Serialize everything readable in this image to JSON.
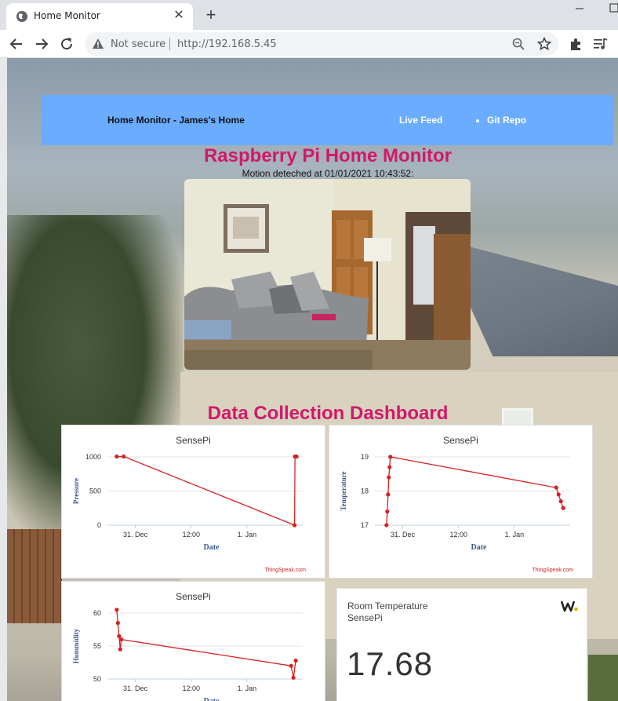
{
  "browser": {
    "tab_title": "Home Monitor",
    "security_label": "Not secure",
    "url": "http://192.168.5.45"
  },
  "nav": {
    "brand": "Home Monitor - James's Home",
    "live_feed": "Live Feed",
    "git_repo": "Git Repo"
  },
  "page": {
    "title": "Raspberry Pi Home Monitor",
    "motion_text": "Motion deteched at 01/01/2021 10:43:52:",
    "dashboard_title": "Data Collection Dashboard"
  },
  "colors": {
    "navbar": "#6aacff",
    "heading": "#d0196a",
    "series": "#d62020",
    "axis_label": "#3b5a8a"
  },
  "chart_data": [
    {
      "type": "line",
      "title": "SensePi",
      "xlabel": "Date",
      "ylabel": "Pressure",
      "x_ticks": [
        "31. Dec",
        "12:00",
        "1. Jan"
      ],
      "y_ticks": [
        0,
        500,
        1000
      ],
      "ylim": [
        0,
        1000
      ],
      "credit": "ThingSpeak.com",
      "series": [
        {
          "points": [
            {
              "x": "2020-12-30T20:00",
              "y": 1005
            },
            {
              "x": "2020-12-30T21:30",
              "y": 1005
            },
            {
              "x": "2021-01-01T10:15",
              "y": 0
            },
            {
              "x": "2021-01-01T10:20",
              "y": 1005
            },
            {
              "x": "2021-01-01T10:30",
              "y": 1005
            },
            {
              "x": "2021-01-01T10:40",
              "y": 1005
            }
          ]
        }
      ]
    },
    {
      "type": "line",
      "title": "SensePi",
      "xlabel": "Date",
      "ylabel": "Temperature",
      "x_ticks": [
        "31. Dec",
        "12:00",
        "1. Jan"
      ],
      "y_ticks": [
        17,
        18,
        19
      ],
      "ylim": [
        17,
        19
      ],
      "credit": "ThingSpeak.com",
      "series": [
        {
          "points": [
            {
              "x": "2020-12-30T20:30",
              "y": 17.0
            },
            {
              "x": "2020-12-30T20:40",
              "y": 17.4
            },
            {
              "x": "2020-12-30T20:50",
              "y": 17.9
            },
            {
              "x": "2020-12-30T21:00",
              "y": 18.4
            },
            {
              "x": "2020-12-30T21:10",
              "y": 18.7
            },
            {
              "x": "2020-12-30T21:20",
              "y": 19.0
            },
            {
              "x": "2021-01-01T09:00",
              "y": 18.1
            },
            {
              "x": "2021-01-01T09:30",
              "y": 17.9
            },
            {
              "x": "2021-01-01T10:00",
              "y": 17.7
            },
            {
              "x": "2021-01-01T10:30",
              "y": 17.5
            }
          ]
        }
      ]
    },
    {
      "type": "line",
      "title": "SensePi",
      "xlabel": "Date",
      "ylabel": "Hummidity",
      "x_ticks": [
        "31. Dec",
        "12:00",
        "1. Jan"
      ],
      "y_ticks": [
        50,
        55,
        60
      ],
      "ylim": [
        50,
        60
      ],
      "series": [
        {
          "points": [
            {
              "x": "2020-12-30T20:00",
              "y": 60.5
            },
            {
              "x": "2020-12-30T20:15",
              "y": 58.5
            },
            {
              "x": "2020-12-30T20:30",
              "y": 56.5
            },
            {
              "x": "2020-12-30T20:45",
              "y": 54.5
            },
            {
              "x": "2020-12-30T21:00",
              "y": 56.0
            },
            {
              "x": "2021-01-01T09:30",
              "y": 52.0
            },
            {
              "x": "2021-01-01T10:00",
              "y": 50.2
            },
            {
              "x": "2021-01-01T10:30",
              "y": 52.8
            }
          ]
        }
      ]
    }
  ],
  "tile": {
    "title": "Room Temperature",
    "subtitle": "SensePi",
    "value": "17.68"
  }
}
